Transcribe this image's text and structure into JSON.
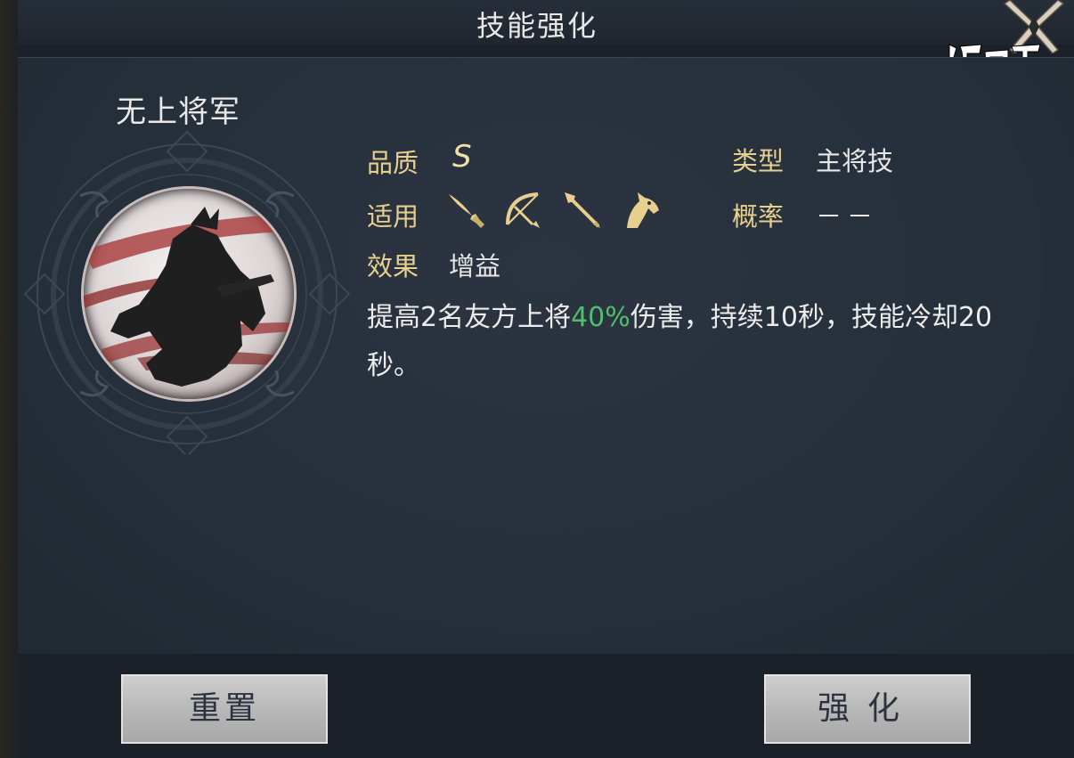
{
  "header": {
    "title": "技能强化",
    "close_icon": "close-x-icon"
  },
  "watermark": {
    "logo_text": "游旧下"
  },
  "skill": {
    "name": "无上将军",
    "icon": "general-silhouette-icon"
  },
  "attributes": {
    "quality_label": "品质",
    "quality_value": "S",
    "type_label": "类型",
    "type_value": "主将技",
    "applicable_label": "适用",
    "applicable_icons": [
      "sword-icon",
      "bow-icon",
      "spear-icon",
      "horse-icon"
    ],
    "probability_label": "概率",
    "probability_value": "－－",
    "effect_label": "效果",
    "effect_value": "增益"
  },
  "description": {
    "before": "提高2名友方上将",
    "highlight": "40%",
    "after": "伤害，持续10秒，技能冷却20秒。"
  },
  "buttons": {
    "reset_label": "重置",
    "enhance_label": "强化"
  },
  "colors": {
    "label_gold": "#e6cf8f",
    "highlight_green": "#4fbf6d",
    "button_gray": "#c0c0c0"
  }
}
